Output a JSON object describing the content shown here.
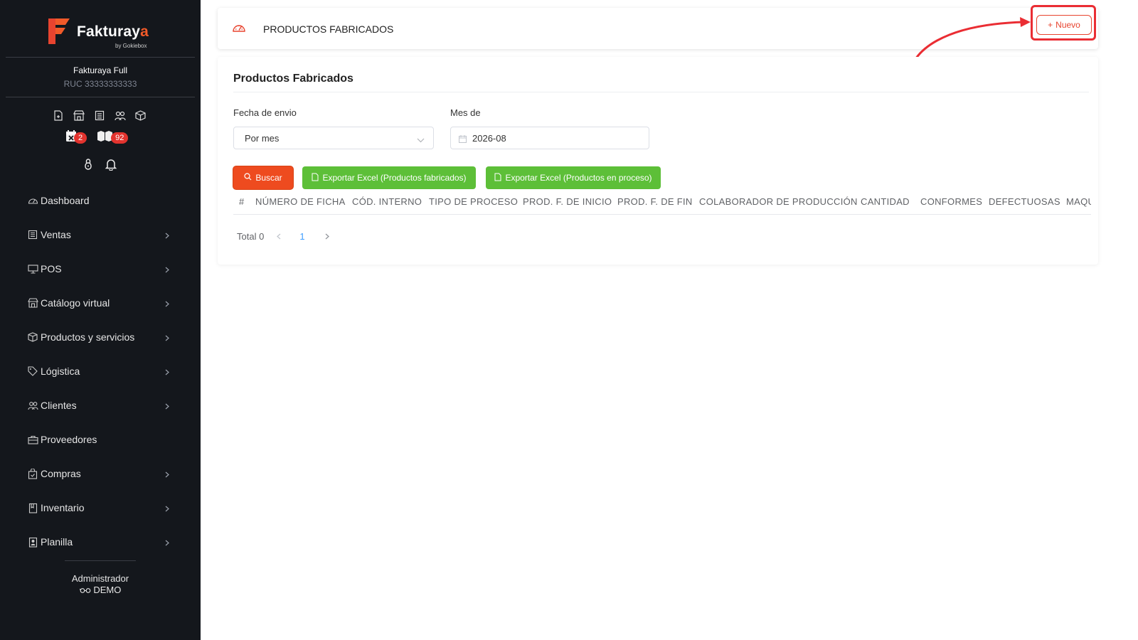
{
  "brand": {
    "name_part1": "Fakturay",
    "name_part2": "a",
    "tagline": "by Gokiebox"
  },
  "company": {
    "name": "Fakturaya Full",
    "ruc": "RUC 33333333333"
  },
  "badges": {
    "calendar": "2",
    "boxes": "92"
  },
  "sidebar": {
    "items": [
      {
        "label": "Dashboard"
      },
      {
        "label": "Ventas"
      },
      {
        "label": "POS"
      },
      {
        "label": "Catálogo virtual"
      },
      {
        "label": "Productos y servicios"
      },
      {
        "label": "Lógistica"
      },
      {
        "label": "Clientes"
      },
      {
        "label": "Proveedores"
      },
      {
        "label": "Compras"
      },
      {
        "label": "Inventario"
      },
      {
        "label": "Planilla"
      }
    ]
  },
  "user": {
    "role": "Administrador",
    "mode": "DEMO"
  },
  "header": {
    "title": "PRODUCTOS FABRICADOS",
    "new_button": "Nuevo"
  },
  "main": {
    "title": "Productos Fabricados",
    "filter_date_label": "Fecha de envio",
    "filter_date_value": "Por mes",
    "month_label": "Mes de",
    "month_value": "2026-08",
    "search_button": "Buscar",
    "export1_button": "Exportar Excel (Productos fabricados)",
    "export2_button": "Exportar Excel (Productos en proceso)",
    "columns": [
      "#",
      "NÚMERO DE FICHA",
      "CÓD. INTERNO",
      "TIPO DE PROCESO",
      "PROD. F. DE INICIO",
      "PROD. F. DE FIN",
      "COLABORADOR DE PRODUCCIÓN",
      "CANTIDAD",
      "CONFORMES",
      "DEFECTUOSAS",
      "MAQUINARIA"
    ],
    "pagination": {
      "total": "Total 0",
      "current_page": "1"
    }
  },
  "colors": {
    "sidebar_bg": "#14171c",
    "accent": "#ee4b1f",
    "excel_green": "#5dbf38",
    "highlight_red": "#ea2d33"
  }
}
